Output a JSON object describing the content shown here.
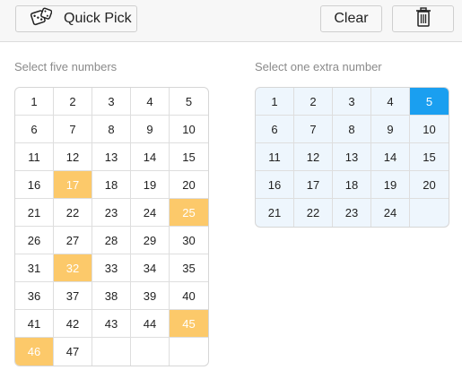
{
  "toolbar": {
    "quick_pick_label": "Quick Pick",
    "quick_pick_icon": "dice-icon",
    "clear_label": "Clear",
    "delete_icon": "trash-icon"
  },
  "main": {
    "label": "Select five numbers",
    "count": 47,
    "selected": [
      17,
      25,
      32,
      45,
      46
    ],
    "selected_color": "#fcc96a"
  },
  "extra": {
    "label": "Select one extra number",
    "count": 24,
    "selected": [
      5
    ],
    "selected_color": "#1a9ff0",
    "background_color": "#eef6fd"
  }
}
